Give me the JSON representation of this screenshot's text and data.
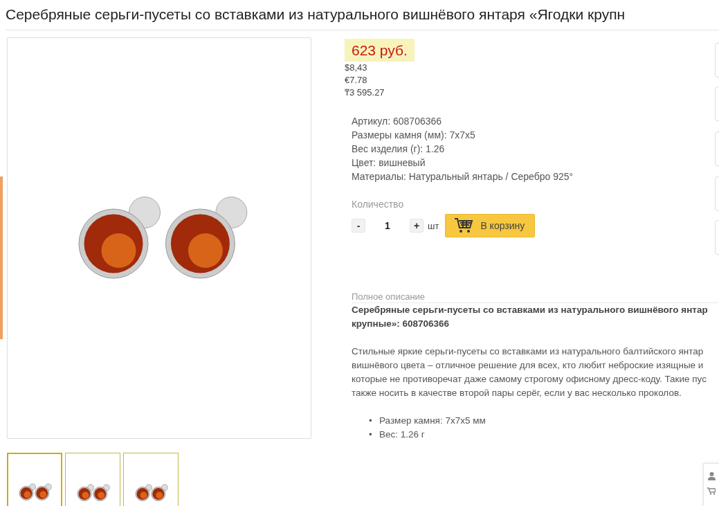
{
  "title": "Серебряные серьги-пусеты со вставками из натурального вишнёвого янтаря «Ягодки крупн",
  "thumbnails": [
    {
      "selected": true
    },
    {
      "selected": false
    },
    {
      "selected": false
    }
  ],
  "price": {
    "main": "623 руб.",
    "other": [
      "$8,43",
      "€7.78",
      "₸3 595.27"
    ]
  },
  "specs": [
    {
      "label": "Артикул:",
      "value": "608706366"
    },
    {
      "label": "Размеры камня (мм):",
      "value": "7x7x5"
    },
    {
      "label": "Вес изделия (г):",
      "value": "1.26"
    },
    {
      "label": "Цвет:",
      "value": "вишневый"
    },
    {
      "label": "Материалы:",
      "value": "Натуральный янтарь / Серебро 925°"
    }
  ],
  "quantity": {
    "label": "Количество",
    "minus": "-",
    "value": "1",
    "plus": "+",
    "unit": "шт"
  },
  "cart_button": "В корзину",
  "description": {
    "heading": "Полное описание",
    "title_lines": [
      "Серебряные серьги-пусеты со вставками из натурального вишнёвого янтар",
      "крупные»: 608706366"
    ],
    "text_lines": [
      "Стильные яркие серьги-пусеты со вставками из натурального балтийского янтар",
      "вишнёвого цвета – отличное решение для всех, кто любит неброские изящные и",
      "которые не противоречат даже самому строгому офисному дресс-коду. Такие пус",
      "также носить в качестве второй пары серёг, если у вас несколько проколов."
    ],
    "bullets": [
      {
        "marker": "•",
        "text": "Размер камня: 7x7x5 мм"
      },
      {
        "marker": "•",
        "text": "Вес: 1.26 г"
      }
    ]
  }
}
